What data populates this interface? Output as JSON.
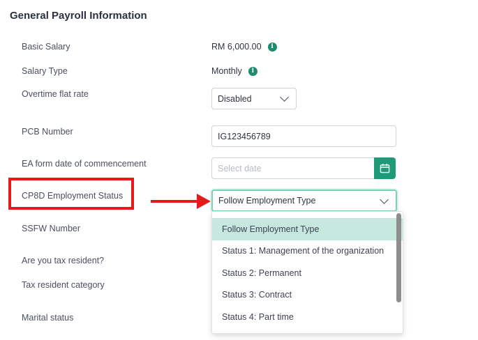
{
  "section": {
    "title": "General Payroll Information"
  },
  "fields": {
    "basic_salary": {
      "label": "Basic Salary",
      "value": "RM 6,000.00"
    },
    "salary_type": {
      "label": "Salary Type",
      "value": "Monthly"
    },
    "overtime": {
      "label": "Overtime flat rate",
      "value": "Disabled"
    },
    "pcb": {
      "label": "PCB Number",
      "value": "IG123456789"
    },
    "ea_form": {
      "label": "EA form date of commencement",
      "placeholder": "Select date"
    },
    "cp8d": {
      "label": "CP8D Employment Status",
      "value": "Follow Employment Type"
    },
    "ssfw": {
      "label": "SSFW Number"
    },
    "tax_resident": {
      "label": "Are you tax resident?"
    },
    "tax_category": {
      "label": "Tax resident category"
    },
    "marital": {
      "label": "Marital status"
    }
  },
  "dropdown": {
    "options": [
      "Follow Employment Type",
      "Status 1: Management of the organization",
      "Status 2: Permanent",
      "Status 3: Contract",
      "Status 4: Part time"
    ]
  },
  "icons": {
    "info": "info-icon",
    "calendar": "calendar-icon",
    "chevron": "chevron-down-icon"
  },
  "colors": {
    "accent": "#1e9a78",
    "highlight": "#e21b1b",
    "selected_option": "#c6e8de"
  }
}
